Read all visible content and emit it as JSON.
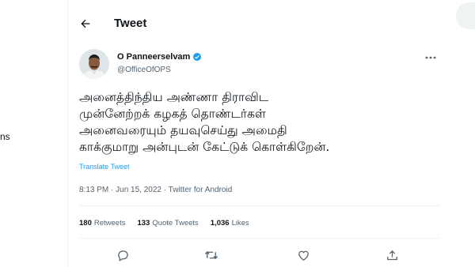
{
  "left": {
    "fragment": "ns"
  },
  "header": {
    "title": "Tweet"
  },
  "tweet": {
    "author": {
      "name": "O Panneerselvam",
      "handle": "@OfficeOfOPS",
      "verified": true
    },
    "lines": [
      "அனைத்திந்திய அண்ணா திராவிட",
      "முன்னேற்றக் கழகத் தொண்டர்கள்",
      "அனைவரையும் தயவுசெய்து அமைதி",
      "காக்குமாறு அன்புடன் கேட்டுக் கொள்கிறேன்."
    ],
    "translate_label": "Translate Tweet",
    "meta": "8:13 PM · Jun 15, 2022 · Twitter for Android",
    "stats": {
      "retweets_count": "180",
      "retweets_label": "Retweets",
      "quotes_count": "133",
      "quotes_label": "Quote Tweets",
      "likes_count": "1,036",
      "likes_label": "Likes"
    }
  },
  "icons": {
    "back": "arrow-left-icon",
    "verified": "verified-badge-icon",
    "more": "more-horizontal-icon",
    "reply": "reply-icon",
    "retweet": "retweet-icon",
    "like": "heart-icon",
    "share": "share-icon"
  },
  "colors": {
    "accent": "#1d9bf0",
    "text": "#0f1419",
    "secondary": "#536471",
    "border": "#eff3f4"
  }
}
